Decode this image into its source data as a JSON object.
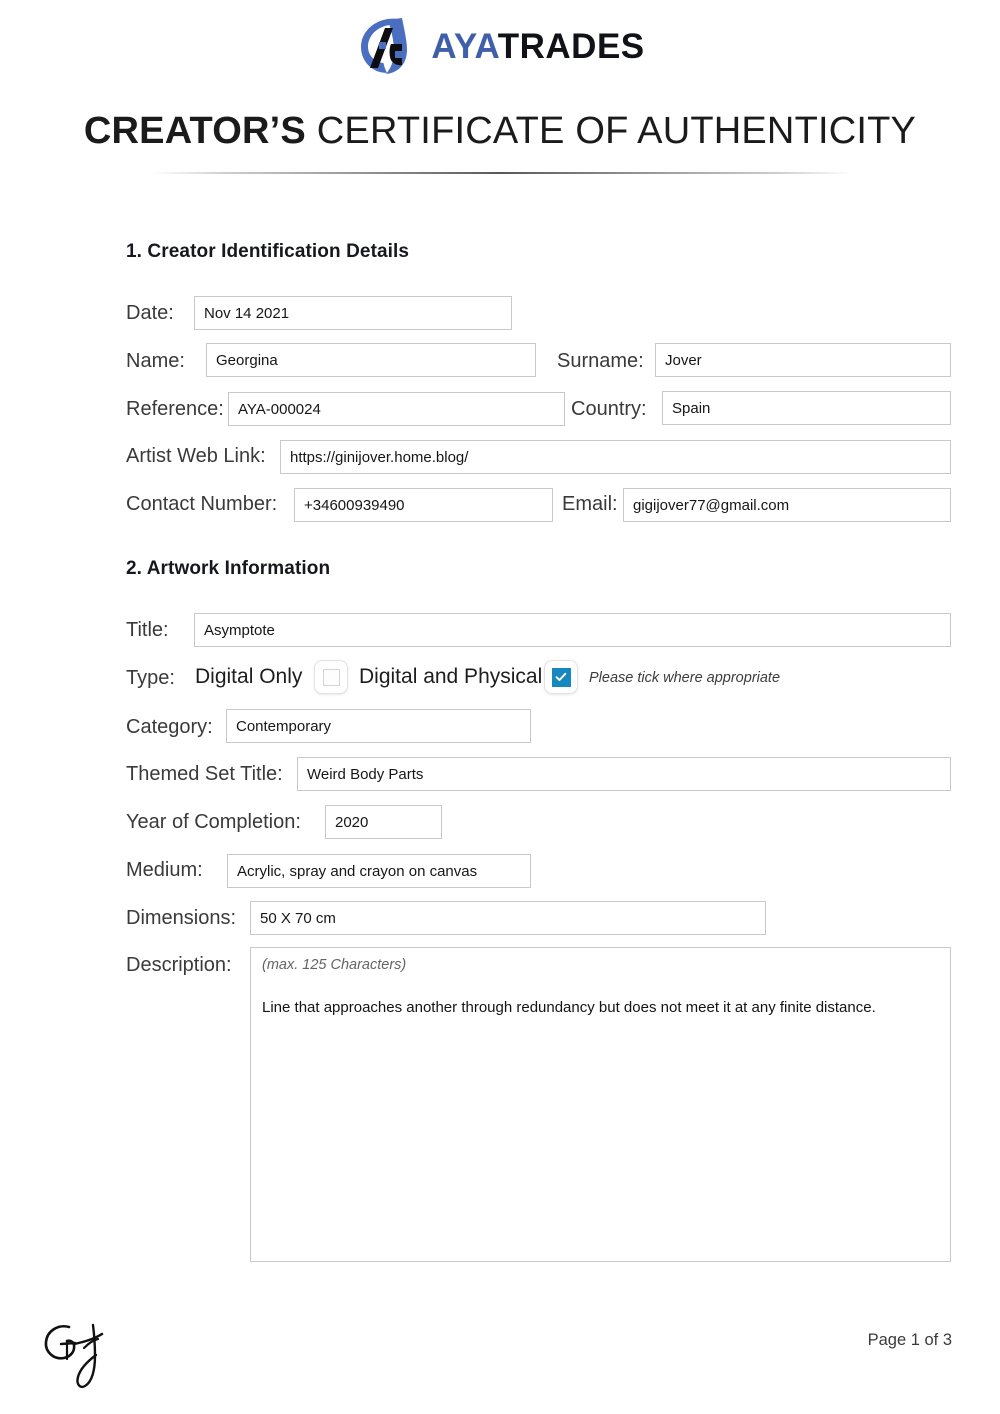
{
  "brand": {
    "name_part1": "AYA",
    "name_part2": "TRADES",
    "logo_icon": "ayatrades-monogram-icon",
    "accent_blue": "#3f5fa8",
    "dark": "#111218"
  },
  "document": {
    "title_bold": "CREATOR’S",
    "title_light": "CERTIFICATE OF AUTHENTICITY"
  },
  "section1": {
    "heading": "1. Creator Identification Details",
    "fields": {
      "date_label": "Date:",
      "date_value": "Nov 14 2021",
      "name_label": "Name:",
      "name_value": "Georgina",
      "surname_label": "Surname:",
      "surname_value": "Jover",
      "reference_label": "Reference:",
      "reference_value": "AYA-000024",
      "country_label": "Country:",
      "country_value": "Spain",
      "weblink_label": "Artist Web Link:",
      "weblink_value": "https://ginijover.home.blog/",
      "contact_label": "Contact Number:",
      "contact_value": "+34600939490",
      "email_label": "Email:",
      "email_value": "gigijover77@gmail.com"
    }
  },
  "section2": {
    "heading": "2. Artwork Information",
    "fields": {
      "title_label": "Title:",
      "title_value": "Asymptote",
      "type_label": "Type:",
      "type_option_digital_only": "Digital Only",
      "type_option_digital_physical": "Digital and Physical",
      "type_hint": "Please tick where appropriate",
      "type_digital_only_checked": false,
      "type_digital_physical_checked": true,
      "checkbox_checked_color": "#1787c0",
      "category_label": "Category:",
      "category_value": "Contemporary",
      "themed_set_label": "Themed Set Title:",
      "themed_set_value": "Weird Body Parts",
      "year_label": "Year of Completion:",
      "year_value": "2020",
      "medium_label": "Medium:",
      "medium_value": "Acrylic, spray and crayon on canvas",
      "dimensions_label": "Dimensions:",
      "dimensions_value": "50 X 70 cm",
      "description_label": "Description:",
      "description_hint": "(max. 125 Characters)",
      "description_value": "Line that approaches another through redundancy but does not meet it at any finite distance."
    }
  },
  "footer": {
    "signature_icon": "handwritten-signature-gj",
    "page_number": "Page 1 of 3"
  }
}
